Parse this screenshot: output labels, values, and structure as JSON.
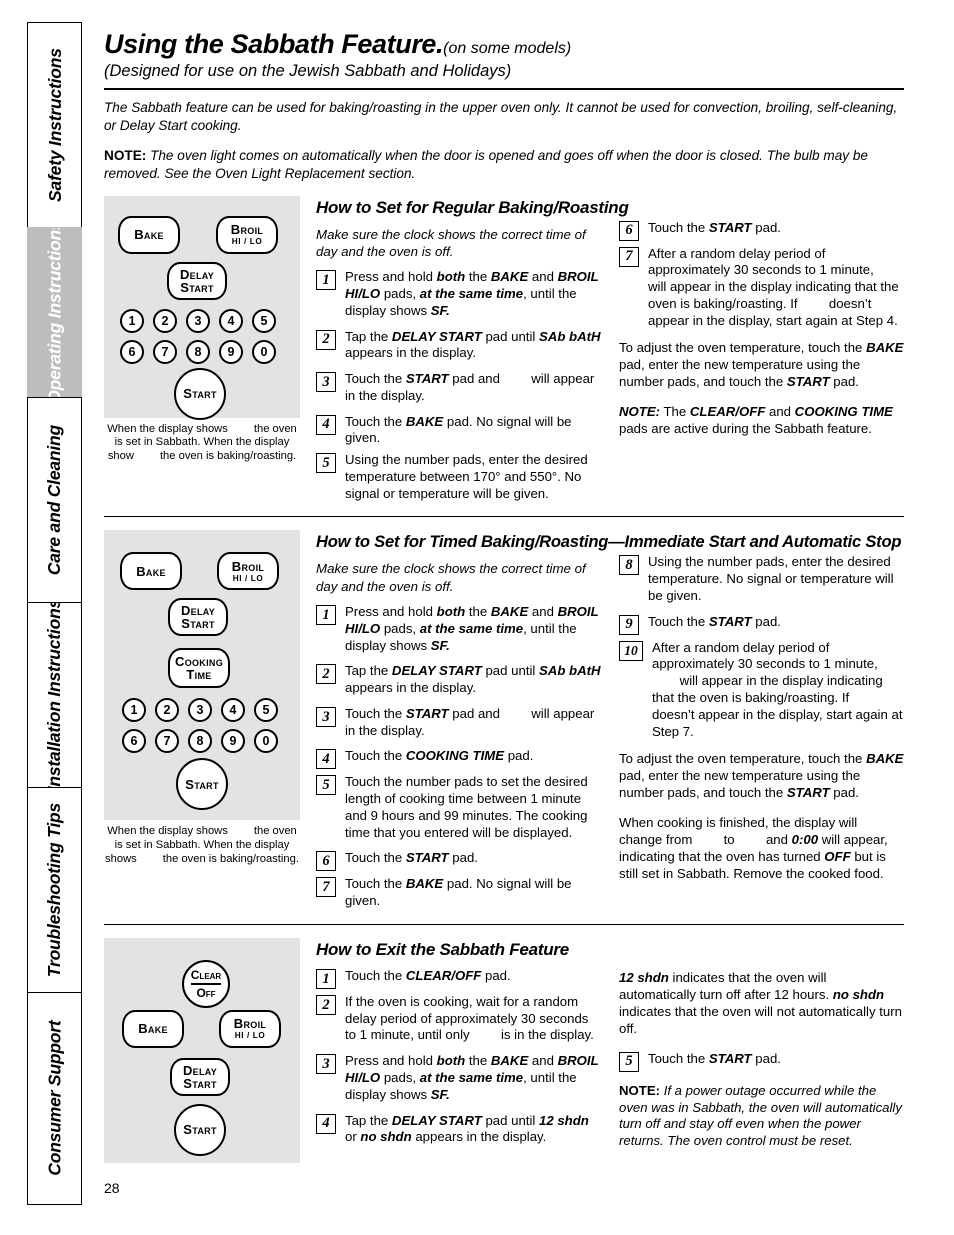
{
  "sidebar": {
    "tabs": [
      {
        "label": "Safety Instructions",
        "active": false
      },
      {
        "label": "Operating Instructions",
        "active": true
      },
      {
        "label": "Care and Cleaning",
        "active": false
      },
      {
        "label": "Installation Instructions",
        "active": false
      },
      {
        "label": "Troubleshooting Tips",
        "active": false
      },
      {
        "label": "Consumer Support",
        "active": false
      }
    ],
    "active_bg": "#bdbdbd",
    "active_fg": "#ffffff"
  },
  "header": {
    "title": "Using the Sabbath Feature.",
    "title_suffix": "(on some models)",
    "subtitle": "(Designed for use on the Jewish Sabbath and Holidays)"
  },
  "intro": {
    "paragraph": "The Sabbath feature can be used for baking/roasting in the upper oven only. It cannot be used for convection, broiling, self-cleaning, or Delay Start cooking.",
    "note_label": "NOTE:",
    "note_text": " The oven light comes on automatically when the door is opened and goes off when the door is closed. The bulb may be removed. See the Oven Light Replacement section."
  },
  "panel_colors": {
    "background": "#e3e3e3",
    "key_fill": "#ffffff",
    "key_stroke": "#000000"
  },
  "panel1": {
    "keys": [
      {
        "name": "bake",
        "label": "Bake"
      },
      {
        "name": "broil",
        "label": "Broil",
        "sub": "HI / LO"
      },
      {
        "name": "delay-start",
        "label": "Delay",
        "label2": "Start"
      },
      {
        "name": "start",
        "label": "Start"
      }
    ],
    "numbers": [
      "1",
      "2",
      "3",
      "4",
      "5",
      "6",
      "7",
      "8",
      "9",
      "0"
    ],
    "caption_a": "When the display shows",
    "caption_b": "the oven is set in Sabbath. When the display show",
    "caption_c": "the oven is baking/roasting."
  },
  "panel2": {
    "keys": [
      {
        "name": "bake",
        "label": "Bake"
      },
      {
        "name": "broil",
        "label": "Broil",
        "sub": "HI / LO"
      },
      {
        "name": "delay-start",
        "label": "Delay",
        "label2": "Start"
      },
      {
        "name": "cooking-time",
        "label": "Cooking",
        "label2": "Time"
      },
      {
        "name": "start",
        "label": "Start"
      }
    ],
    "numbers": [
      "1",
      "2",
      "3",
      "4",
      "5",
      "6",
      "7",
      "8",
      "9",
      "0"
    ],
    "caption_a": "When the display shows",
    "caption_b": "the oven is set in Sabbath. When the display shows",
    "caption_c": "the oven is baking/roasting."
  },
  "panel3": {
    "keys": [
      {
        "name": "clear-off",
        "label": "Clear",
        "label2": "Off"
      },
      {
        "name": "bake",
        "label": "Bake"
      },
      {
        "name": "broil",
        "label": "Broil",
        "sub": "HI / LO"
      },
      {
        "name": "delay-start",
        "label": "Delay",
        "label2": "Start"
      },
      {
        "name": "start",
        "label": "Start"
      }
    ]
  },
  "section1": {
    "heading": "How to Set for Regular Baking/Roasting",
    "lead": "Make sure the clock shows the correct time of day and the oven is off.",
    "steps_left": [
      {
        "num": "1",
        "html": "Press and hold <b>both</b> the <b>BAKE</b> and <b>BROIL HI/LO</b> pads, <b>at the same time</b>, until the display shows <b>SF.</b>"
      },
      {
        "num": "2",
        "html": "Tap the <b>DELAY START</b> pad until <b>SAb bAtH</b> appears in the display."
      },
      {
        "num": "3",
        "html": "Touch the <b>START</b> pad and <span class=\"gap\"></span> will appear in the display."
      },
      {
        "num": "4",
        "html": "Touch the <b>BAKE</b> pad. No signal will be given."
      },
      {
        "num": "5",
        "html": "Using the number pads, enter the desired temperature between 170° and 550°. No signal or temperature will be given."
      }
    ],
    "steps_right": [
      {
        "num": "6",
        "html": "Touch the <b>START</b> pad."
      },
      {
        "num": "7",
        "html": "After a random delay period of approximately 30 seconds to 1 minute, <span class=\"gap\"></span> will appear in the display indicating that the oven is baking/roasting. If <span class=\"gap\"></span> doesn’t appear in the display, start again at Step 4."
      }
    ],
    "para_right_1": "To adjust the oven temperature, touch the <b>BAKE</b> pad, enter the new temperature using the number pads, and touch the <b>START</b> pad.",
    "para_right_note": "<b class=\"lbl\">NOTE:</b> The <b>CLEAR/OFF</b> and <b>COOKING TIME</b> pads are active during the Sabbath feature."
  },
  "section2": {
    "heading": "How to Set for Timed Baking/Roasting—Immediate Start and Automatic Stop",
    "lead": "Make sure the clock shows the correct time of day and the oven is off.",
    "steps_left": [
      {
        "num": "1",
        "html": "Press and hold <b>both</b> the <b>BAKE</b> and <b>BROIL HI/LO</b> pads, <b>at the same time</b>, until the display shows <b>SF.</b>"
      },
      {
        "num": "2",
        "html": "Tap the <b>DELAY START</b> pad until <b>SAb bAtH</b> appears in the display."
      },
      {
        "num": "3",
        "html": "Touch the <b>START</b> pad and <span class=\"gap\"></span> will appear in the display."
      },
      {
        "num": "4",
        "html": "Touch the <b>COOKING TIME</b> pad."
      },
      {
        "num": "5",
        "html": "Touch the number pads to set the desired length of cooking time between 1 minute and 9 hours and 99 minutes. The cooking time that you entered will be displayed."
      },
      {
        "num": "6",
        "html": "Touch the <b>START</b> pad."
      },
      {
        "num": "7",
        "html": "Touch the <b>BAKE</b> pad. No signal will be given."
      }
    ],
    "steps_right": [
      {
        "num": "8",
        "html": "Using the number pads, enter the desired temperature. No signal or temperature will be given."
      },
      {
        "num": "9",
        "html": "Touch the <b>START</b> pad."
      },
      {
        "num": "10",
        "html": "After a random delay period of approximately 30 seconds to 1 minute, <span class=\"gap\"></span> will appear in the display indicating that the oven is baking/roasting. If <span class=\"gap\"></span> doesn’t appear in the display, start again at Step 7."
      }
    ],
    "para_right_1": "To adjust the oven temperature, touch the <b>BAKE</b> pad, enter the new temperature using the number pads, and touch the <b>START</b> pad.",
    "para_right_2": "When cooking is finished, the display will change from <span class=\"gap\"></span> to <span class=\"gap\"></span> and <b>0:00</b> will appear, indicating that the oven has turned <b>OFF</b> but is still set in Sabbath. Remove the cooked food."
  },
  "section3": {
    "heading": "How to Exit the Sabbath Feature",
    "steps_left": [
      {
        "num": "1",
        "html": "Touch the <b>CLEAR/OFF</b> pad."
      },
      {
        "num": "2",
        "html": "If the oven is cooking, wait for a random delay period of approximately 30 seconds to 1 minute, until only <span class=\"gap\"></span> is in the display."
      },
      {
        "num": "3",
        "html": "Press and hold <b>both</b> the <b>BAKE</b> and <b>BROIL HI/LO</b> pads, <b>at the same time</b>, until the display shows <b>SF.</b>"
      },
      {
        "num": "4",
        "html": "Tap the <b>DELAY START</b> pad until <b>12 shdn</b> or <b>no shdn</b> appears in the display."
      }
    ],
    "para_right_1": "<b>12 shdn</b> indicates that the oven will automatically turn off after 12 hours. <b>no shdn</b> indicates that the oven will not automatically turn off.",
    "steps_right": [
      {
        "num": "5",
        "html": "Touch the <b>START</b> pad."
      }
    ],
    "para_right_note": "<b class=\"lbl\">NOTE:</b> If a power outage occurred while the oven was in Sabbath, the oven will automatically turn off and stay off even when the power returns. The oven control must be reset."
  },
  "footer": {
    "page_number": "28"
  }
}
